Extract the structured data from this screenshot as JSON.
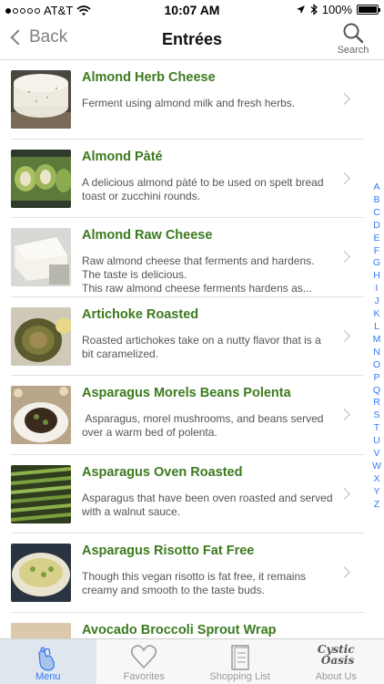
{
  "status_bar": {
    "carrier": "AT&T",
    "time": "10:07 AM",
    "battery": "100%",
    "battery_level": 1.0
  },
  "nav": {
    "back_label": "Back",
    "title": "Entrées",
    "search_label": "Search"
  },
  "items": [
    {
      "title": "Almond Herb Cheese",
      "desc": "Ferment using almond milk and fresh herbs.",
      "icon": "almond-cheese-wheel"
    },
    {
      "title": "Almond Pàté",
      "desc": "A delicious almond pàté to be used on spelt bread toast or zucchini rounds.",
      "icon": "zucchini-rolls"
    },
    {
      "title": "Almond Raw Cheese",
      "desc": "Raw almond cheese that ferments and hardens. The taste is delicious.\nThis raw almond cheese ferments hardens as...",
      "icon": "cheese-wedge"
    },
    {
      "title": "Artichoke Roasted",
      "desc": "Roasted artichokes take on a nutty flavor that is a bit caramelized.",
      "icon": "artichoke"
    },
    {
      "title": "Asparagus Morels Beans Polenta",
      "desc": " Asparagus, morel mushrooms, and beans served over a warm bed of polenta.",
      "icon": "polenta-plate"
    },
    {
      "title": "Asparagus Oven Roasted",
      "desc": "Asparagus that have been oven roasted and served with a walnut sauce.",
      "icon": "asparagus"
    },
    {
      "title": "Asparagus Risotto Fat Free",
      "desc": "Though this vegan risotto is fat free, it remains creamy and smooth to the taste buds.",
      "icon": "risotto"
    },
    {
      "title": "Avocado Broccoli Sprout Wrap",
      "desc": "",
      "icon": "wrap"
    }
  ],
  "index_letters": [
    "A",
    "B",
    "C",
    "D",
    "E",
    "F",
    "G",
    "H",
    "I",
    "J",
    "K",
    "L",
    "M",
    "N",
    "O",
    "P",
    "Q",
    "R",
    "S",
    "T",
    "U",
    "V",
    "W",
    "X",
    "Y",
    "Z"
  ],
  "tabs": [
    {
      "label": "Menu",
      "icon": "hands-menu-icon",
      "active": true
    },
    {
      "label": "Favorites",
      "icon": "heart-icon",
      "active": false
    },
    {
      "label": "Shopping List",
      "icon": "shopping-list-icon",
      "active": false
    },
    {
      "label": "About Us",
      "icon": "cystic-oasis-logo",
      "active": false
    }
  ],
  "logo_text": [
    "Cystic",
    "Oasis"
  ],
  "colors": {
    "title_green": "#3c7a1e",
    "link_blue": "#3478f6",
    "chevron_gray": "#b8b8b8"
  }
}
